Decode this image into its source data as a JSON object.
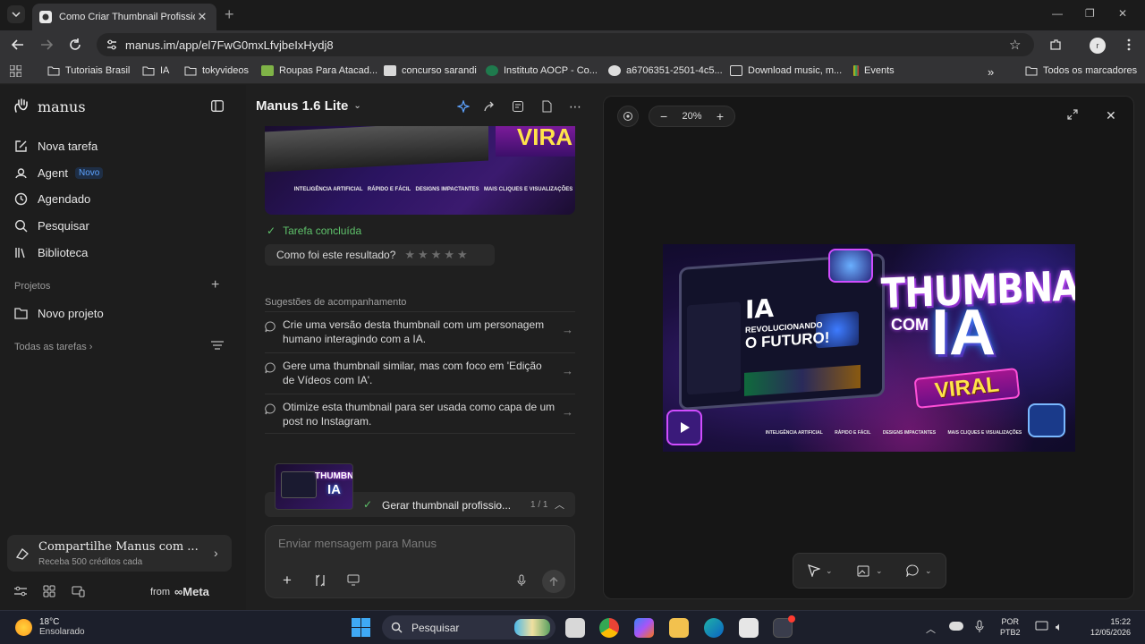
{
  "browser": {
    "tab_title": "Como Criar Thumbnail Profissio",
    "url": "manus.im/app/el7FwG0mxLfvjbeIxHydj8",
    "profile_initial": "r",
    "bookmarks": [
      {
        "label": "Tutoriais Brasil",
        "icon": "folder-icon"
      },
      {
        "label": "IA",
        "icon": "folder-icon"
      },
      {
        "label": "tokyvideos",
        "icon": "folder-icon"
      },
      {
        "label": "Roupas Para Atacad...",
        "icon": "site-icon"
      },
      {
        "label": "concurso sarandi",
        "icon": "site-icon"
      },
      {
        "label": "Instituto AOCP - Co...",
        "icon": "site-icon"
      },
      {
        "label": "a6706351-2501-4c5...",
        "icon": "site-icon"
      },
      {
        "label": "Download music, m...",
        "icon": "site-icon"
      },
      {
        "label": "Events",
        "icon": "site-icon"
      }
    ],
    "all_bookmarks": "Todos os marcadores"
  },
  "sidebar": {
    "brand": "manus",
    "items": [
      {
        "label": "Nova tarefa"
      },
      {
        "label": "Agent",
        "badge": "Novo"
      },
      {
        "label": "Agendado"
      },
      {
        "label": "Pesquisar"
      },
      {
        "label": "Biblioteca"
      }
    ],
    "projects_label": "Projetos",
    "new_project": "Novo projeto",
    "all_tasks": "Todas as tarefas",
    "share_title": "Compartilhe Manus com ...",
    "share_sub": "Receba 500 créditos cada",
    "from_label": "from",
    "meta_label": "Meta"
  },
  "chat": {
    "model": "Manus 1.6 Lite",
    "task_done": "Tarefa concluída",
    "rating_prompt": "Como foi este resultado?",
    "stars": "★★★★★",
    "suggestions_title": "Sugestões de acompanhamento",
    "suggestions": [
      "Crie uma versão desta thumbnail com um personagem humano interagindo com a IA.",
      "Gere uma thumbnail similar, mas com foco em 'Edição de Vídeos com IA'.",
      "Otimize esta thumbnail para ser usada como capa de um post no Instagram."
    ],
    "task_title": "Gerar thumbnail profissio...",
    "task_count": "1 / 1",
    "input_placeholder": "Enviar mensagem para Manus"
  },
  "preview": {
    "zoom": "20%",
    "thumbnail": {
      "ia": "IA",
      "revolucionando": "REVOLUCIONANDO",
      "futuro": "O FUTURO!",
      "title": "THUMBNAIL",
      "com": "COM",
      "big_ia": "IA",
      "viral": "VIRAL",
      "features": [
        "INTELIGÊNCIA ARTIFICIAL",
        "RÁPIDO E FÁCIL",
        "DESIGNS IMPACTANTES",
        "MAIS CLIQUES E VISUALIZAÇÕES"
      ]
    }
  },
  "taskbar": {
    "temp": "18°C",
    "weather": "Ensolarado",
    "search": "Pesquisar",
    "lang1": "POR",
    "lang2": "PTB2",
    "time": "15:22",
    "date": "12/05/2026"
  },
  "colors": {
    "accent_green": "#5fc26b",
    "accent_blue": "#5da3ff"
  }
}
